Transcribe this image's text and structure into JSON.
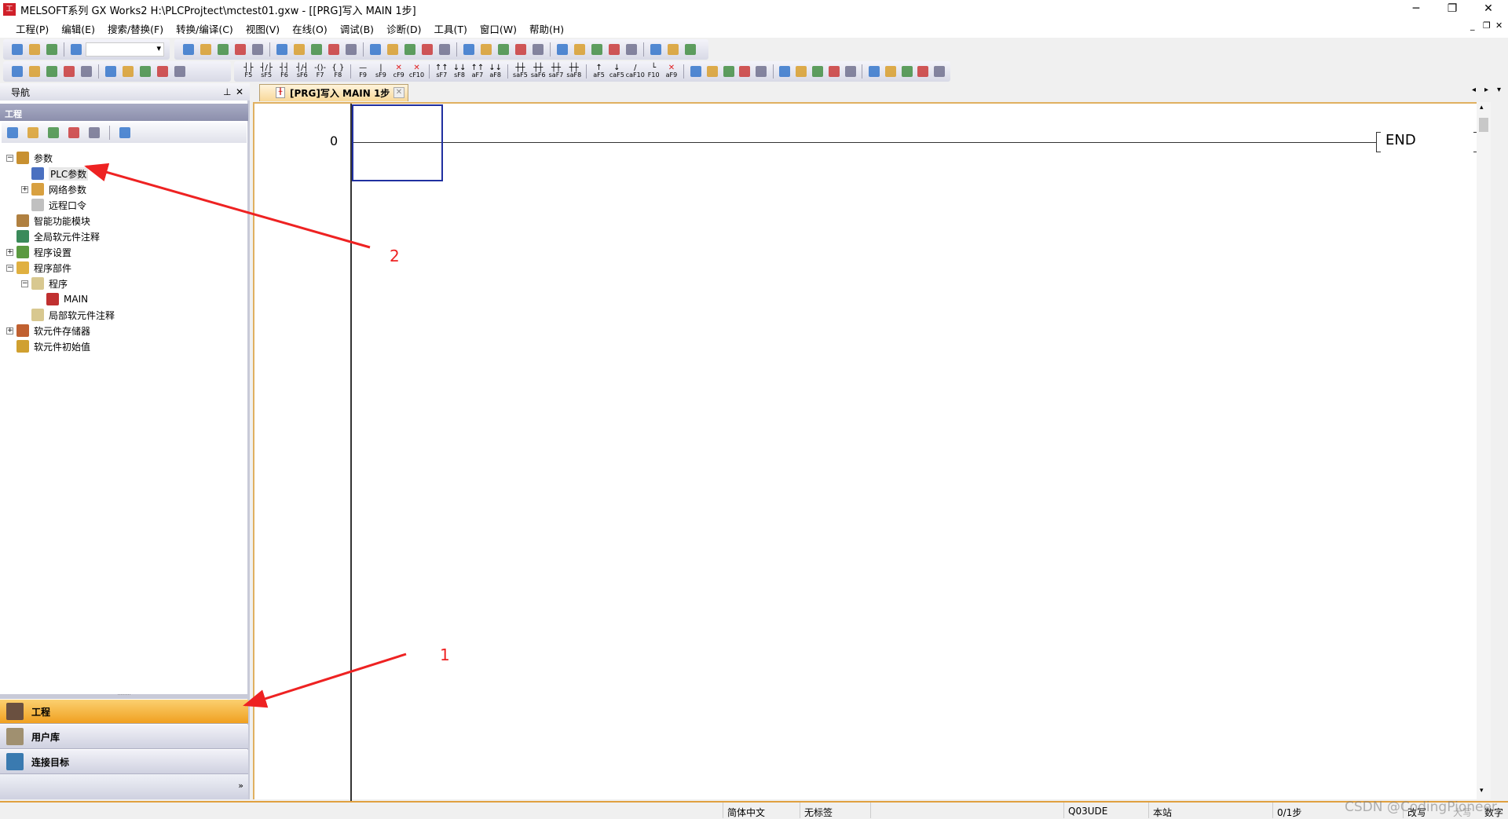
{
  "window": {
    "title": "MELSOFT系列 GX Works2 H:\\PLCProjtect\\mctest01.gxw - [[PRG]写入 MAIN 1步]",
    "minimize": "─",
    "restore": "❐",
    "close": "✕"
  },
  "menu": [
    "工程(P)",
    "编辑(E)",
    "搜索/替换(F)",
    "转换/编译(C)",
    "视图(V)",
    "在线(O)",
    "调试(B)",
    "诊断(D)",
    "工具(T)",
    "窗口(W)",
    "帮助(H)"
  ],
  "toolbar1": {
    "icons": [
      "new-icon",
      "open-icon",
      "save-icon",
      "help-icon"
    ],
    "combo_value": "",
    "icons2": [
      "cut-icon",
      "copy-icon",
      "paste-icon",
      "undo-icon",
      "redo-icon",
      "device-search-icon",
      "device-batch-icon",
      "device-replace-icon",
      "write-to-plc-icon",
      "read-from-plc-icon",
      "verify-icon",
      "monitor-icon",
      "monitor-stop-icon",
      "monitor-write-icon",
      "device-register-icon",
      "device-test-icon",
      "watch-icon",
      "trace-icon",
      "remote-icon",
      "sampling-trace-icon",
      "simulation-icon",
      "plc-diagnostic-icon",
      "ladder-start-icon",
      "ladder-stop-icon",
      "step-run-icon",
      "device-chart-icon",
      "wave-icon",
      "scope-icon"
    ]
  },
  "toolbar2": {
    "icons": [
      "project-tree-icon",
      "module-icon",
      "list-icon",
      "dev-icon",
      "dev-list-icon",
      "dev-ccl-icon",
      "dev-view-icon",
      "find-device-icon",
      "help-question-icon",
      "binoculars-icon"
    ],
    "keys": [
      {
        "g": "┤├",
        "k": "F5"
      },
      {
        "g": "┤/├",
        "k": "sF5"
      },
      {
        "g": "┤┤",
        "k": "F6"
      },
      {
        "g": "┤/┤",
        "k": "sF6"
      },
      {
        "g": "-()-",
        "k": "F7"
      },
      {
        "g": "{ }",
        "k": "F8"
      },
      {
        "g": "—",
        "k": "F9"
      },
      {
        "g": "|",
        "k": "sF9"
      },
      {
        "g": "✕",
        "k": "cF9"
      },
      {
        "g": "✕",
        "k": "cF10"
      },
      {
        "g": "↑↑",
        "k": "sF7"
      },
      {
        "g": "↓↓",
        "k": "sF8"
      },
      {
        "g": "↑↑",
        "k": "aF7"
      },
      {
        "g": "↓↓",
        "k": "aF8"
      },
      {
        "g": "┼┼",
        "k": "saF5"
      },
      {
        "g": "┼┼",
        "k": "saF6"
      },
      {
        "g": "┼┼",
        "k": "saF7"
      },
      {
        "g": "┼┼",
        "k": "saF8"
      },
      {
        "g": "↑",
        "k": "aF5"
      },
      {
        "g": "↓",
        "k": "caF5"
      },
      {
        "g": "/",
        "k": "caF10"
      },
      {
        "g": "└",
        "k": "F10"
      },
      {
        "g": "✕",
        "k": "aF9"
      }
    ],
    "icons2": [
      "st-icon",
      "edit-ladder-icon",
      "comment-icon",
      "statement-icon",
      "note-icon",
      "statement-list-icon",
      "doc-icon",
      "zoom-in-icon",
      "zoom-out-icon",
      "ladder-mode-icon",
      "write-mode-icon",
      "read-mode-icon",
      "monitor-mode-icon",
      "dev-monitor-icon",
      "zoom-icon"
    ]
  },
  "nav": {
    "title": "导航",
    "pin": "ᵖ",
    "close": "✕",
    "section": "工程",
    "tree_icons": [
      "new-data-icon",
      "copy-data-icon",
      "paste-data-icon",
      "property-icon",
      "refresh-icon",
      "plc-type-icon"
    ],
    "tree": [
      {
        "label": "参数",
        "expander": "−",
        "level": 0
      },
      {
        "label": "PLC参数",
        "expander": "",
        "level": 1,
        "selected": true
      },
      {
        "label": "网络参数",
        "expander": "+",
        "level": 1
      },
      {
        "label": "远程口令",
        "expander": "",
        "level": 1
      },
      {
        "label": "智能功能模块",
        "expander": "",
        "level": 0
      },
      {
        "label": "全局软元件注释",
        "expander": "",
        "level": 0
      },
      {
        "label": "程序设置",
        "expander": "+",
        "level": 0
      },
      {
        "label": "程序部件",
        "expander": "−",
        "level": 0
      },
      {
        "label": "程序",
        "expander": "−",
        "level": 1
      },
      {
        "label": "MAIN",
        "expander": "",
        "level": 2
      },
      {
        "label": "局部软元件注释",
        "expander": "",
        "level": 1
      },
      {
        "label": "软元件存储器",
        "expander": "+",
        "level": 0
      },
      {
        "label": "软元件初始值",
        "expander": "",
        "level": 0
      }
    ],
    "bottom": [
      {
        "label": "工程",
        "active": true
      },
      {
        "label": "用户库"
      },
      {
        "label": "连接目标"
      }
    ],
    "more": "»"
  },
  "editor": {
    "tab_label": "[PRG]写入 MAIN 1步",
    "tab_close": "✕",
    "step": "0",
    "end": "END"
  },
  "annotations": {
    "arrow1": "1",
    "arrow2": "2",
    "color": "#ee2222"
  },
  "status": {
    "lang": "简体中文",
    "label": "无标签",
    "cpu": "Q03UDE",
    "station": "本站",
    "steps": "0/1步",
    "mode": "改写",
    "caps": "大写",
    "num": "数字"
  },
  "watermark": "CSDN @CodingPioneer",
  "colors": {
    "active_panel": "#f5b030",
    "cursor": "#2030a0"
  }
}
